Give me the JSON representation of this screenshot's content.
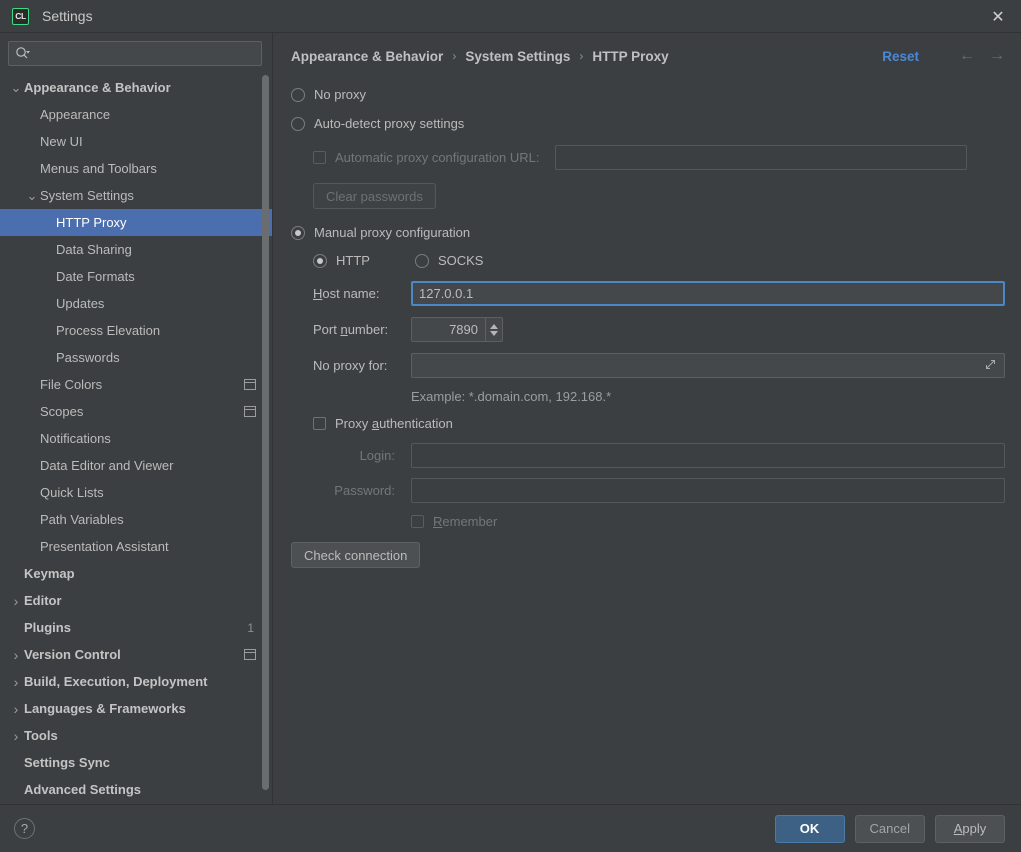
{
  "window": {
    "title": "Settings",
    "app_icon": "CL",
    "close_icon": "✕"
  },
  "sidebar": {
    "search": {
      "placeholder": "",
      "value": "",
      "icon": "search-icon"
    },
    "items": [
      {
        "label": "Appearance & Behavior",
        "indent": 0,
        "bold": true,
        "arrow": "expanded"
      },
      {
        "label": "Appearance",
        "indent": 1,
        "bold": false,
        "arrow": "none"
      },
      {
        "label": "New UI",
        "indent": 1,
        "bold": false,
        "arrow": "none"
      },
      {
        "label": "Menus and Toolbars",
        "indent": 1,
        "bold": false,
        "arrow": "none"
      },
      {
        "label": "System Settings",
        "indent": 1,
        "bold": false,
        "arrow": "expanded"
      },
      {
        "label": "HTTP Proxy",
        "indent": 2,
        "bold": false,
        "arrow": "none",
        "selected": true
      },
      {
        "label": "Data Sharing",
        "indent": 2,
        "bold": false,
        "arrow": "none"
      },
      {
        "label": "Date Formats",
        "indent": 2,
        "bold": false,
        "arrow": "none"
      },
      {
        "label": "Updates",
        "indent": 2,
        "bold": false,
        "arrow": "none"
      },
      {
        "label": "Process Elevation",
        "indent": 2,
        "bold": false,
        "arrow": "none"
      },
      {
        "label": "Passwords",
        "indent": 2,
        "bold": false,
        "arrow": "none"
      },
      {
        "label": "File Colors",
        "indent": 1,
        "bold": false,
        "arrow": "none",
        "panel_icon": true
      },
      {
        "label": "Scopes",
        "indent": 1,
        "bold": false,
        "arrow": "none",
        "panel_icon": true
      },
      {
        "label": "Notifications",
        "indent": 1,
        "bold": false,
        "arrow": "none"
      },
      {
        "label": "Data Editor and Viewer",
        "indent": 1,
        "bold": false,
        "arrow": "none"
      },
      {
        "label": "Quick Lists",
        "indent": 1,
        "bold": false,
        "arrow": "none"
      },
      {
        "label": "Path Variables",
        "indent": 1,
        "bold": false,
        "arrow": "none"
      },
      {
        "label": "Presentation Assistant",
        "indent": 1,
        "bold": false,
        "arrow": "none"
      },
      {
        "label": "Keymap",
        "indent": 0,
        "bold": true,
        "arrow": "none"
      },
      {
        "label": "Editor",
        "indent": 0,
        "bold": true,
        "arrow": "collapsed"
      },
      {
        "label": "Plugins",
        "indent": 0,
        "bold": true,
        "arrow": "none",
        "badge": "1"
      },
      {
        "label": "Version Control",
        "indent": 0,
        "bold": true,
        "arrow": "collapsed",
        "panel_icon": true
      },
      {
        "label": "Build, Execution, Deployment",
        "indent": 0,
        "bold": true,
        "arrow": "collapsed"
      },
      {
        "label": "Languages & Frameworks",
        "indent": 0,
        "bold": true,
        "arrow": "collapsed"
      },
      {
        "label": "Tools",
        "indent": 0,
        "bold": true,
        "arrow": "collapsed"
      },
      {
        "label": "Settings Sync",
        "indent": 0,
        "bold": true,
        "arrow": "none"
      },
      {
        "label": "Advanced Settings",
        "indent": 0,
        "bold": true,
        "arrow": "none"
      }
    ]
  },
  "header": {
    "breadcrumb": [
      "Appearance & Behavior",
      "System Settings",
      "HTTP Proxy"
    ],
    "separator": "›",
    "reset_label": "Reset",
    "back_icon": "←",
    "forward_icon": "→"
  },
  "proxy": {
    "no_proxy_label": "No proxy",
    "no_proxy_selected": false,
    "auto_detect_label": "Auto-detect proxy settings",
    "auto_detect_selected": false,
    "auto_config_url_label": "Automatic proxy configuration URL:",
    "auto_config_url_checked": false,
    "auto_config_url_value": "",
    "clear_passwords_label": "Clear passwords",
    "manual_label": "Manual proxy configuration",
    "manual_selected": true,
    "http_label": "HTTP",
    "http_selected": true,
    "socks_label": "SOCKS",
    "socks_selected": false,
    "host_name_label": "Host name:",
    "host_name_mnemonic": "H",
    "host_name_rest": "ost name:",
    "host_name_value": "127.0.0.1",
    "port_label_pre": "Port ",
    "port_label_mn": "n",
    "port_label_post": "umber:",
    "port_value": "7890",
    "no_proxy_for_label": "No proxy for:",
    "no_proxy_for_value": "",
    "expand_icon": "expand-icon",
    "example_text": "Example: *.domain.com, 192.168.*",
    "proxy_auth_pre": "Proxy ",
    "proxy_auth_mn": "a",
    "proxy_auth_post": "uthentication",
    "proxy_auth_checked": false,
    "login_label": "Login:",
    "login_value": "",
    "password_label": "Password:",
    "password_value": "",
    "remember_mn": "R",
    "remember_post": "emember",
    "remember_checked": false,
    "check_connection_label": "Check connection"
  },
  "footer": {
    "help_icon": "?",
    "ok_label": "OK",
    "cancel_label": "Cancel",
    "apply_mn": "A",
    "apply_post": "pply"
  },
  "colors": {
    "accent_blue": "#4b6eaf",
    "link_blue": "#4a88d8",
    "focus_blue": "#4a88c7",
    "panel_bg": "#3c3f41",
    "icon_green": "#3ddc84"
  }
}
